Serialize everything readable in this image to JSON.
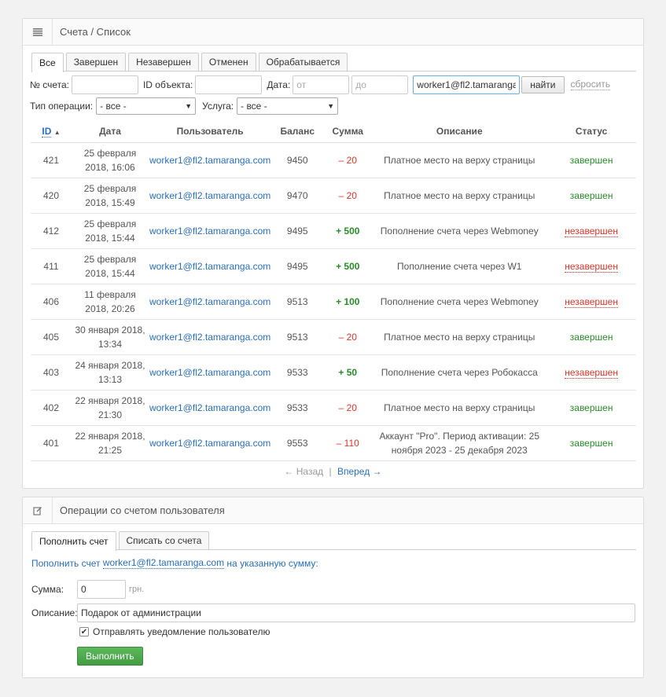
{
  "accounts_panel": {
    "title": "Счета / Список",
    "tabs": [
      "Все",
      "Завершен",
      "Незавершен",
      "Отменен",
      "Обрабатывается"
    ],
    "filters": {
      "account_no_label": "№ счета:",
      "account_no_value": "",
      "object_id_label": "ID объекта:",
      "object_id_value": "",
      "date_label": "Дата:",
      "date_from_placeholder": "от",
      "date_to_placeholder": "до",
      "user_value": "worker1@fl2.tamaranga",
      "find_button": "найти",
      "reset_link": "сбросить",
      "op_type_label": "Тип операции:",
      "op_type_value": "- все -",
      "service_label": "Услуга:",
      "service_value": "- все -"
    },
    "table": {
      "headers": [
        "ID",
        "Дата",
        "Пользователь",
        "Баланс",
        "Сумма",
        "Описание",
        "Статус"
      ],
      "rows": [
        {
          "id": "421",
          "date1": "25 февраля",
          "date2": "2018, 16:06",
          "user": "worker1@fl2.tamaranga.com",
          "balance": "9450",
          "sum": "– 20",
          "sum_type": "neg",
          "desc1": "Платное место на верху страницы",
          "desc2": "",
          "status": "завершен",
          "status_type": "done"
        },
        {
          "id": "420",
          "date1": "25 февраля",
          "date2": "2018, 15:49",
          "user": "worker1@fl2.tamaranga.com",
          "balance": "9470",
          "sum": "– 20",
          "sum_type": "neg",
          "desc1": "Платное место на верху страницы",
          "desc2": "",
          "status": "завершен",
          "status_type": "done"
        },
        {
          "id": "412",
          "date1": "25 февраля",
          "date2": "2018, 15:44",
          "user": "worker1@fl2.tamaranga.com",
          "balance": "9495",
          "sum": "+ 500",
          "sum_type": "pos",
          "desc1": "Пополнение счета через Webmoney",
          "desc2": "",
          "status": "незавершен",
          "status_type": "undone"
        },
        {
          "id": "411",
          "date1": "25 февраля",
          "date2": "2018, 15:44",
          "user": "worker1@fl2.tamaranga.com",
          "balance": "9495",
          "sum": "+ 500",
          "sum_type": "pos",
          "desc1": "Пополнение счета через W1",
          "desc2": "",
          "status": "незавершен",
          "status_type": "undone"
        },
        {
          "id": "406",
          "date1": "11 февраля",
          "date2": "2018, 20:26",
          "user": "worker1@fl2.tamaranga.com",
          "balance": "9513",
          "sum": "+ 100",
          "sum_type": "pos",
          "desc1": "Пополнение счета через Webmoney",
          "desc2": "",
          "status": "незавершен",
          "status_type": "undone"
        },
        {
          "id": "405",
          "date1": "30 января 2018,",
          "date2": "13:34",
          "user": "worker1@fl2.tamaranga.com",
          "balance": "9513",
          "sum": "– 20",
          "sum_type": "neg",
          "desc1": "Платное место на верху страницы",
          "desc2": "",
          "status": "завершен",
          "status_type": "done"
        },
        {
          "id": "403",
          "date1": "24 января 2018,",
          "date2": "13:13",
          "user": "worker1@fl2.tamaranga.com",
          "balance": "9533",
          "sum": "+ 50",
          "sum_type": "pos",
          "desc1": "Пополнение счета через Робокасса",
          "desc2": "",
          "status": "незавершен",
          "status_type": "undone"
        },
        {
          "id": "402",
          "date1": "22 января 2018,",
          "date2": "21:30",
          "user": "worker1@fl2.tamaranga.com",
          "balance": "9533",
          "sum": "– 20",
          "sum_type": "neg",
          "desc1": "Платное место на верху страницы",
          "desc2": "",
          "status": "завершен",
          "status_type": "done"
        },
        {
          "id": "401",
          "date1": "22 января 2018,",
          "date2": "21:25",
          "user": "worker1@fl2.tamaranga.com",
          "balance": "9553",
          "sum": "– 110",
          "sum_type": "neg",
          "desc1": "Аккаунт \"Pro\". Период активации: 25",
          "desc2": "ноября 2023 - 25 декабря 2023",
          "status": "завершен",
          "status_type": "done"
        }
      ]
    },
    "pager": {
      "prev": "← Назад",
      "sep": "|",
      "next": "Вперед →"
    }
  },
  "operations_panel": {
    "title": "Операции со счетом пользователя",
    "tabs": [
      "Пополнить счет",
      "Списать со счета"
    ],
    "hint_prefix": "Пополнить счет ",
    "hint_user": "worker1@fl2.tamaranga.com",
    "hint_suffix": " на указанную сумму:",
    "amount_label": "Сумма:",
    "amount_value": "0",
    "currency": "грн.",
    "description_label": "Описание:",
    "description_value": "Подарок от администрации",
    "notify_label": "Отправлять уведомление пользователю",
    "notify_checked": true,
    "submit_button": "Выполнить"
  }
}
